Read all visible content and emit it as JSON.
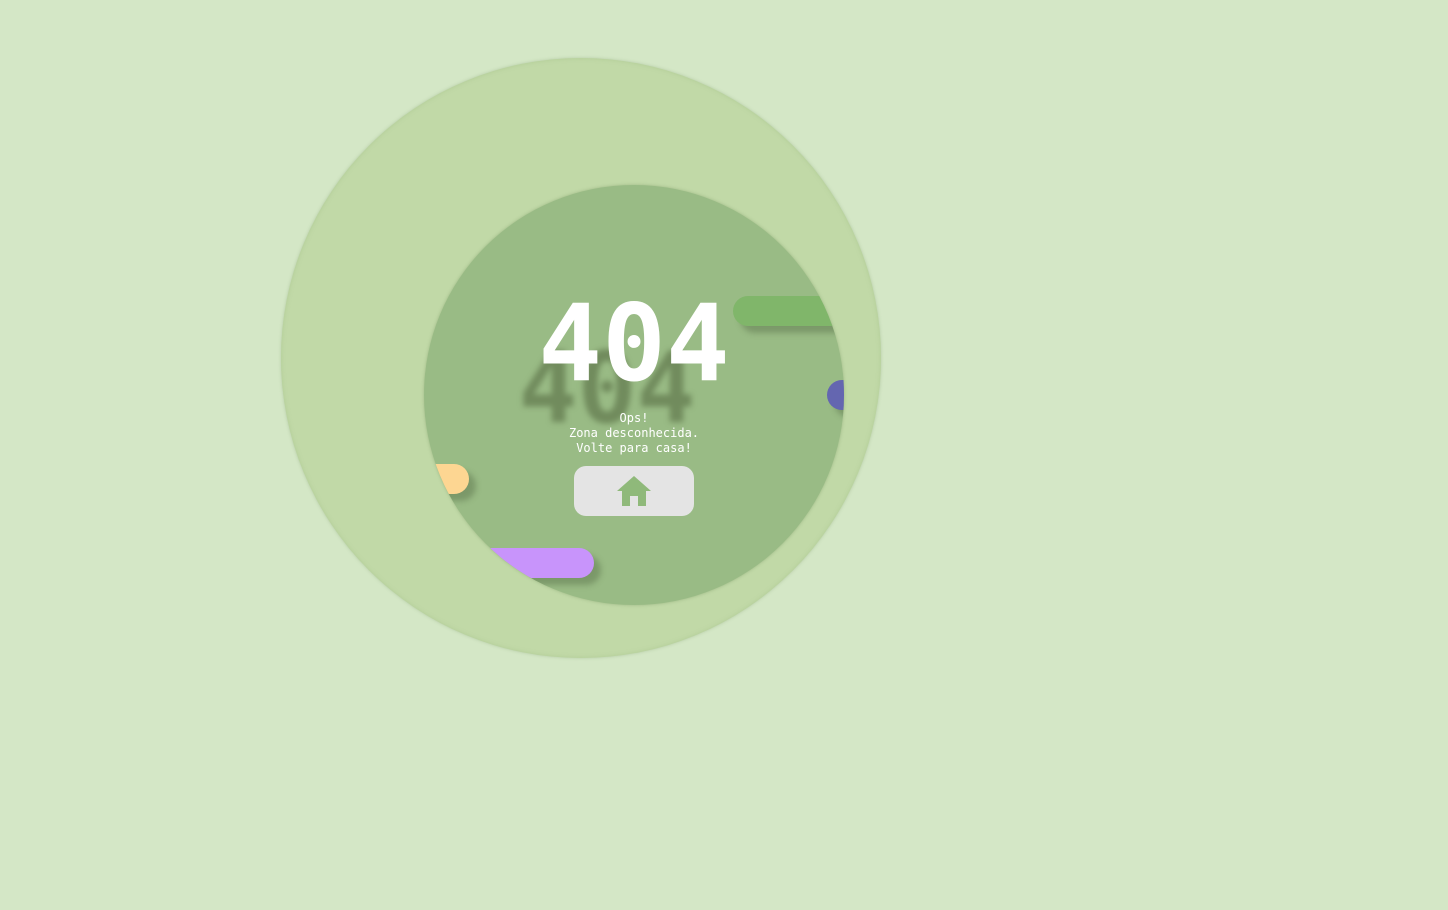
{
  "error": {
    "code": "404",
    "lines": [
      "Ops!",
      "Zona desconhecida.",
      "Volte para casa!"
    ]
  },
  "home_button": {
    "icon": "home-icon"
  },
  "colors": {
    "background": "#d4e7c6",
    "outer_circle": "#c1d9a7",
    "inner_circle": "#99bb85",
    "pill_green": "#80b66a",
    "pill_blue": "#6466b0",
    "pill_yellow": "#fdd692",
    "pill_purple": "#c894fb",
    "button": "#e4e4e4"
  }
}
